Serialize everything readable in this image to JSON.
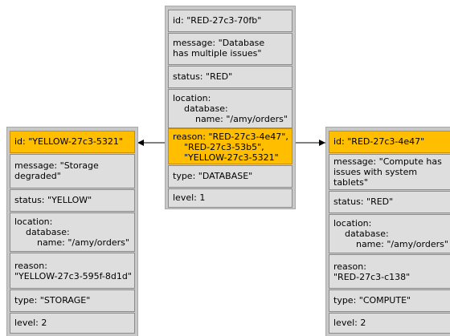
{
  "nodes": [
    {
      "id": "center",
      "fields": [
        {
          "text": "id: \"RED-27c3-70fb\"",
          "highlight": false
        },
        {
          "text": "message: \"Database\nhas multiple issues\"",
          "highlight": false
        },
        {
          "text": "status: \"RED\"",
          "highlight": false
        },
        {
          "text": "location:\n    database:\n        name: \"/amy/orders\"",
          "highlight": false
        },
        {
          "text": "reason: \"RED-27c3-4e47\",\n    \"RED-27c3-53b5\",\n    \"YELLOW-27c3-5321\"",
          "highlight": true
        },
        {
          "text": "type: \"DATABASE\"",
          "highlight": false
        },
        {
          "text": "level: 1",
          "highlight": false
        }
      ]
    },
    {
      "id": "left",
      "fields": [
        {
          "text": "id: \"YELLOW-27c3-5321\"",
          "highlight": true
        },
        {
          "text": "message: \"Storage\ndegraded\"",
          "highlight": false
        },
        {
          "text": "status: \"YELLOW\"",
          "highlight": false
        },
        {
          "text": "location:\n    database:\n        name: \"/amy/orders\"",
          "highlight": false
        },
        {
          "text": "reason:\n\"YELLOW-27c3-595f-8d1d\"",
          "highlight": false
        },
        {
          "text": "type: \"STORAGE\"",
          "highlight": false
        },
        {
          "text": "level: 2",
          "highlight": false
        }
      ]
    },
    {
      "id": "right",
      "fields": [
        {
          "text": "id: \"RED-27c3-4e47\"",
          "highlight": true
        },
        {
          "text": "message: \"Compute has\nissues with system\ntablets\"",
          "highlight": false
        },
        {
          "text": "status: \"RED\"",
          "highlight": false
        },
        {
          "text": "location:\n    database:\n        name: \"/amy/orders\"",
          "highlight": false
        },
        {
          "text": "reason:\n\"RED-27c3-c138\"",
          "highlight": false
        },
        {
          "text": "type: \"COMPUTE\"",
          "highlight": false
        },
        {
          "text": "level: 2",
          "highlight": false
        }
      ]
    }
  ],
  "edges": [
    {
      "from": "center",
      "from_field": 4,
      "to": "left",
      "to_field": 0
    },
    {
      "from": "center",
      "from_field": 4,
      "to": "right",
      "to_field": 0
    }
  ]
}
